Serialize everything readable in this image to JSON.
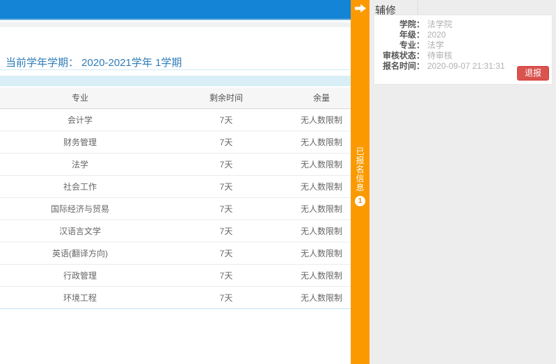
{
  "main": {
    "current_term_title": "当前学年学期： 2020-2021学年 1学期",
    "table": {
      "headers": [
        "专业",
        "剩余时间",
        "余量"
      ],
      "rows": [
        {
          "major": "会计学",
          "time": "7天",
          "quota": "无人数限制"
        },
        {
          "major": "财务管理",
          "time": "7天",
          "quota": "无人数限制"
        },
        {
          "major": "法学",
          "time": "7天",
          "quota": "无人数限制"
        },
        {
          "major": "社会工作",
          "time": "7天",
          "quota": "无人数限制"
        },
        {
          "major": "国际经济与贸易",
          "time": "7天",
          "quota": "无人数限制"
        },
        {
          "major": "汉语言文学",
          "time": "7天",
          "quota": "无人数限制"
        },
        {
          "major": "英语(翻译方向)",
          "time": "7天",
          "quota": "无人数限制"
        },
        {
          "major": "行政管理",
          "time": "7天",
          "quota": "无人数限制"
        },
        {
          "major": "环境工程",
          "time": "7天",
          "quota": "无人数限制"
        }
      ]
    }
  },
  "side_tab": {
    "arrow_icon": "arrow-right",
    "label": "已报名信息",
    "badge": "1"
  },
  "panel": {
    "title": "辅修",
    "fields": [
      {
        "label": "学院：",
        "value": "法学院"
      },
      {
        "label": "年级：",
        "value": "2020"
      },
      {
        "label": "专业：",
        "value": "法学"
      },
      {
        "label": "审核状态：",
        "value": "待审核"
      },
      {
        "label": "报名时间：",
        "value": "2020-09-07 21:31:31"
      }
    ],
    "withdraw_button": "退报"
  },
  "colors": {
    "topbar_blue": "#1484d6",
    "title_blue": "#2e7cb8",
    "info_strip_cyan": "#d9eef7",
    "tab_orange": "#fa9a00",
    "panel_gray": "#ededed",
    "danger_red": "#d9534f",
    "value_gray": "#b0b0b0"
  }
}
